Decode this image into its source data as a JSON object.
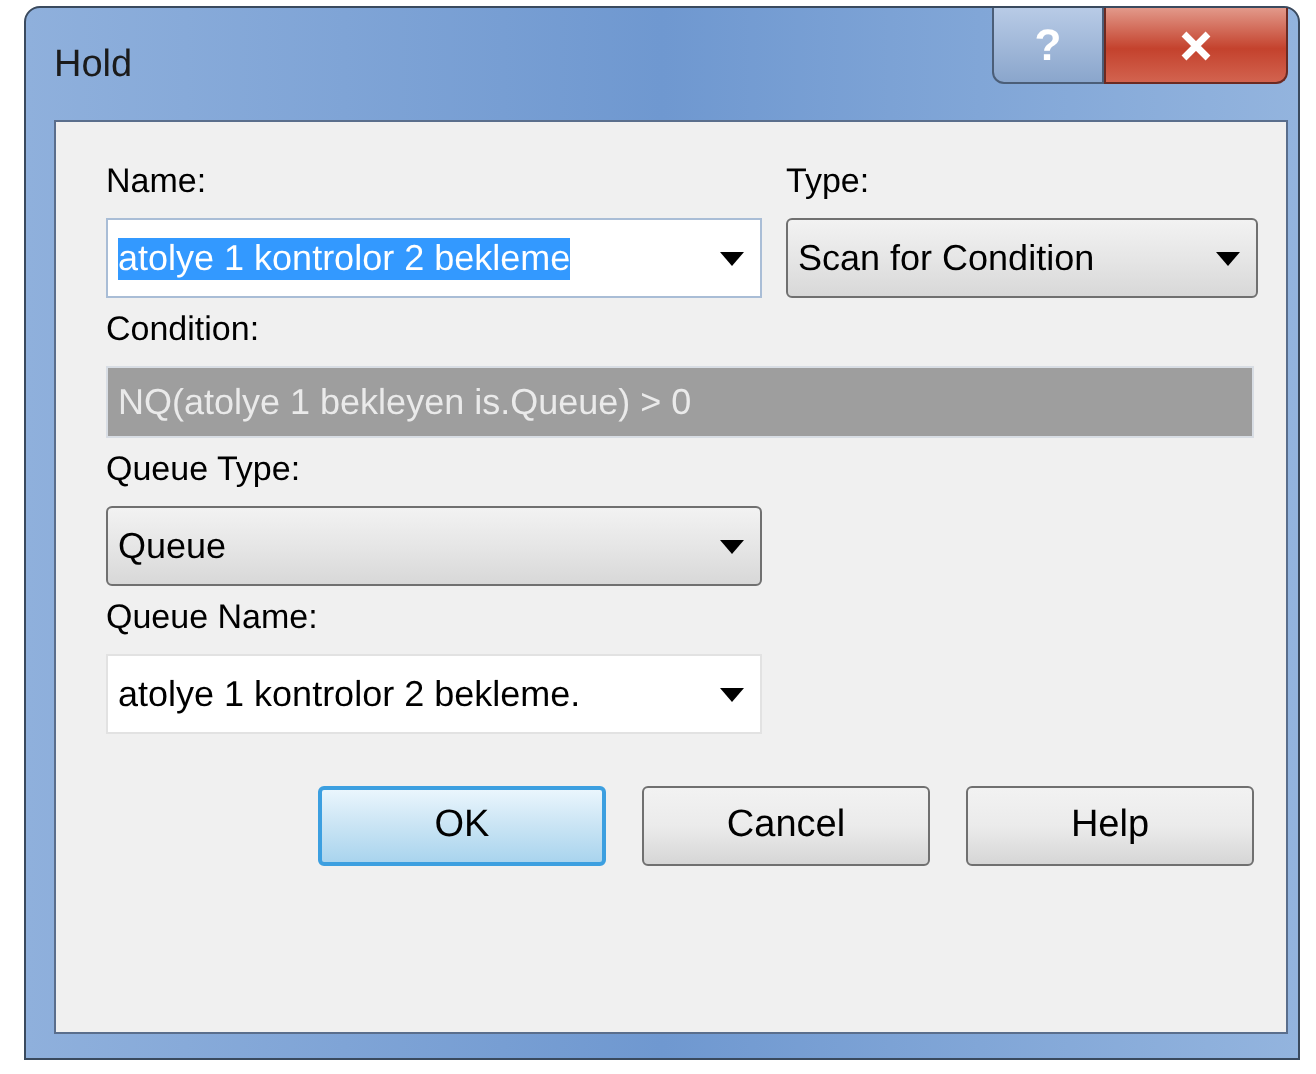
{
  "window": {
    "title": "Hold",
    "help_button": "?"
  },
  "name": {
    "label": "Name:",
    "value": "atolye 1 kontrolor 2 bekleme",
    "text_selected": true
  },
  "type": {
    "label": "Type:",
    "value": "Scan for Condition"
  },
  "condition": {
    "label": "Condition:",
    "value": "NQ(atolye 1 bekleyen is.Queue) > 0",
    "disabled": true
  },
  "queue_type": {
    "label": "Queue Type:",
    "value": "Queue"
  },
  "queue_name": {
    "label": "Queue Name:",
    "value": "atolye 1 kontrolor 2 bekleme."
  },
  "buttons": [
    {
      "label": "OK",
      "default": true
    },
    {
      "label": "Cancel",
      "default": false
    },
    {
      "label": "Help",
      "default": false
    }
  ]
}
